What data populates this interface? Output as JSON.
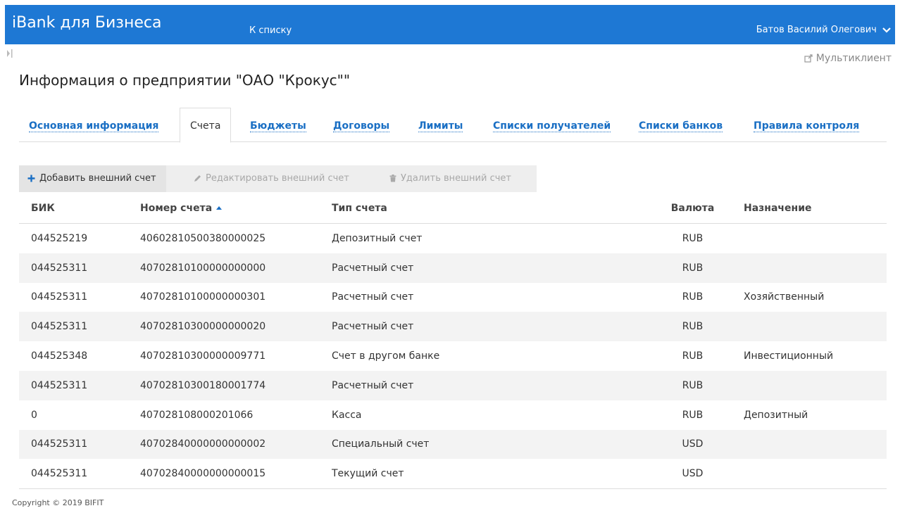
{
  "header": {
    "brand": "iBank для Бизнеса",
    "back_link": "К списку",
    "user_name": "Батов Василий Олегович"
  },
  "multiclient": "Мультиклиент",
  "page_title": "Информация о предприятии \"ОАО \"Крокус\"\"",
  "tabs": [
    {
      "label": "Основная информация",
      "active": false
    },
    {
      "label": "Счета",
      "active": true
    },
    {
      "label": "Бюджеты",
      "active": false
    },
    {
      "label": "Договоры",
      "active": false
    },
    {
      "label": "Лимиты",
      "active": false
    },
    {
      "label": "Списки получателей",
      "active": false
    },
    {
      "label": "Списки банков",
      "active": false
    },
    {
      "label": "Правила контроля",
      "active": false
    }
  ],
  "toolbar": {
    "add": "Добавить внешний счет",
    "edit": "Редактировать внешний счет",
    "delete": "Удалить внешний счет"
  },
  "table": {
    "columns": [
      "БИК",
      "Номер счета",
      "Тип счета",
      "Валюта",
      "Назначение"
    ],
    "rows": [
      [
        "044525219",
        "40602810500380000025",
        "Депозитный счет",
        "RUB",
        ""
      ],
      [
        "044525311",
        "40702810100000000000",
        "Расчетный счет",
        "RUB",
        ""
      ],
      [
        "044525311",
        "40702810100000000301",
        "Расчетный счет",
        "RUB",
        "Хозяйственный"
      ],
      [
        "044525311",
        "40702810300000000020",
        "Расчетный счет",
        "RUB",
        ""
      ],
      [
        "044525348",
        "40702810300000009771",
        "Счет в другом банке",
        "RUB",
        "Инвестиционный"
      ],
      [
        "044525311",
        "40702810300180001774",
        "Расчетный счет",
        "RUB",
        ""
      ],
      [
        "0",
        "407028108000201066",
        "Касса",
        "RUB",
        "Депозитный"
      ],
      [
        "044525311",
        "40702840000000000002",
        "Специальный счет",
        "USD",
        ""
      ],
      [
        "044525311",
        "40702840000000000015",
        "Текущий счет",
        "USD",
        ""
      ]
    ]
  },
  "footer": "Copyright © 2019 BIFIT",
  "colors": {
    "header_bg": "#1e78d4",
    "link": "#1a6fc4",
    "toolbar_bg": "#eeeeee",
    "row_alt": "#f3f3f3"
  }
}
